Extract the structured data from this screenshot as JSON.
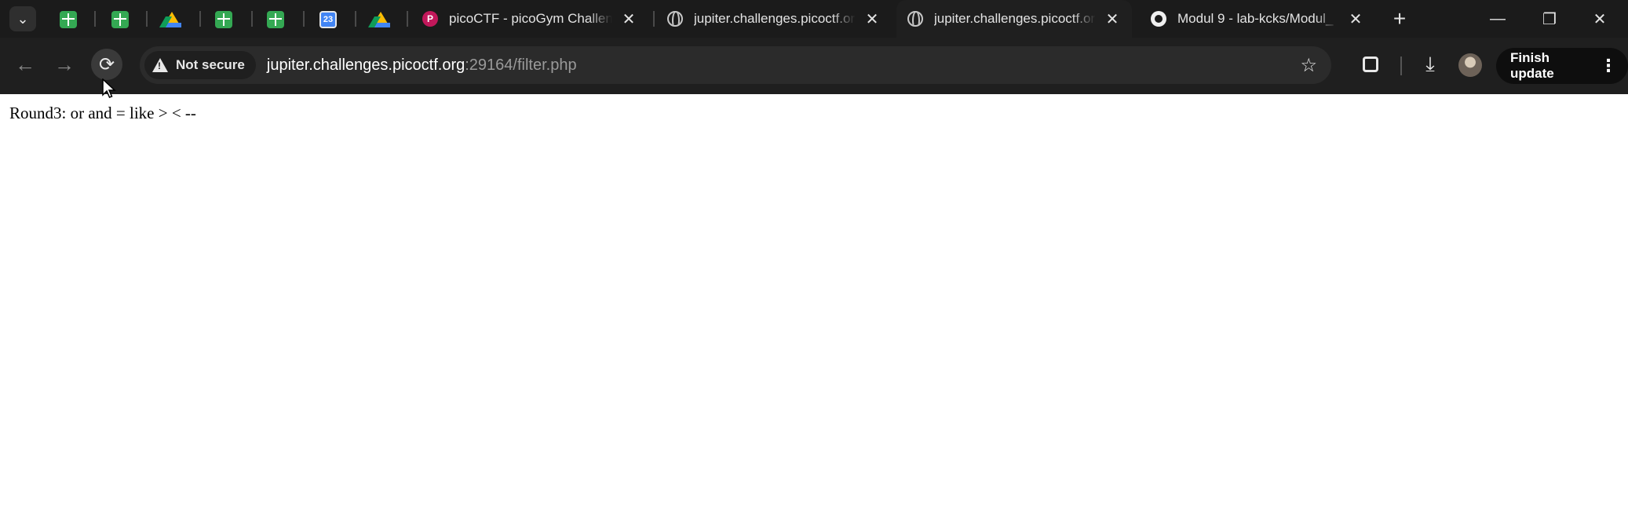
{
  "tabs": {
    "pinned": [
      {
        "icon": "google-sheets-icon"
      },
      {
        "icon": "google-sheets-icon"
      },
      {
        "icon": "google-drive-icon"
      },
      {
        "icon": "google-sheets-icon"
      },
      {
        "icon": "google-sheets-icon"
      },
      {
        "icon": "google-calendar-icon",
        "label": "23"
      },
      {
        "icon": "google-drive-icon"
      }
    ],
    "items": [
      {
        "title": "picoCTF - picoGym Challen",
        "icon": "picoctf-icon",
        "active": false
      },
      {
        "title": "jupiter.challenges.picoctf.or",
        "icon": "globe-icon",
        "active": false
      },
      {
        "title": "jupiter.challenges.picoctf.or",
        "icon": "globe-icon",
        "active": true
      },
      {
        "title": "Modul 9 - lab-kcks/Modul_",
        "icon": "github-icon",
        "active": false
      }
    ],
    "close_glyph": "✕",
    "new_tab_glyph": "+"
  },
  "window_controls": {
    "minimize": "—",
    "restore": "❐",
    "close": "✕"
  },
  "toolbar": {
    "security_label": "Not secure",
    "url_host": "jupiter.challenges.picoctf.org",
    "url_path": ":29164/filter.php",
    "finish_update_label": "Finish update"
  },
  "page": {
    "text": "Round3: or and = like > < --"
  },
  "colors": {
    "tabstrip_bg": "#1b1b1b",
    "toolbar_bg": "#1f1f1f",
    "omnibox_bg": "#2b2b2b",
    "page_bg": "#ffffff"
  }
}
